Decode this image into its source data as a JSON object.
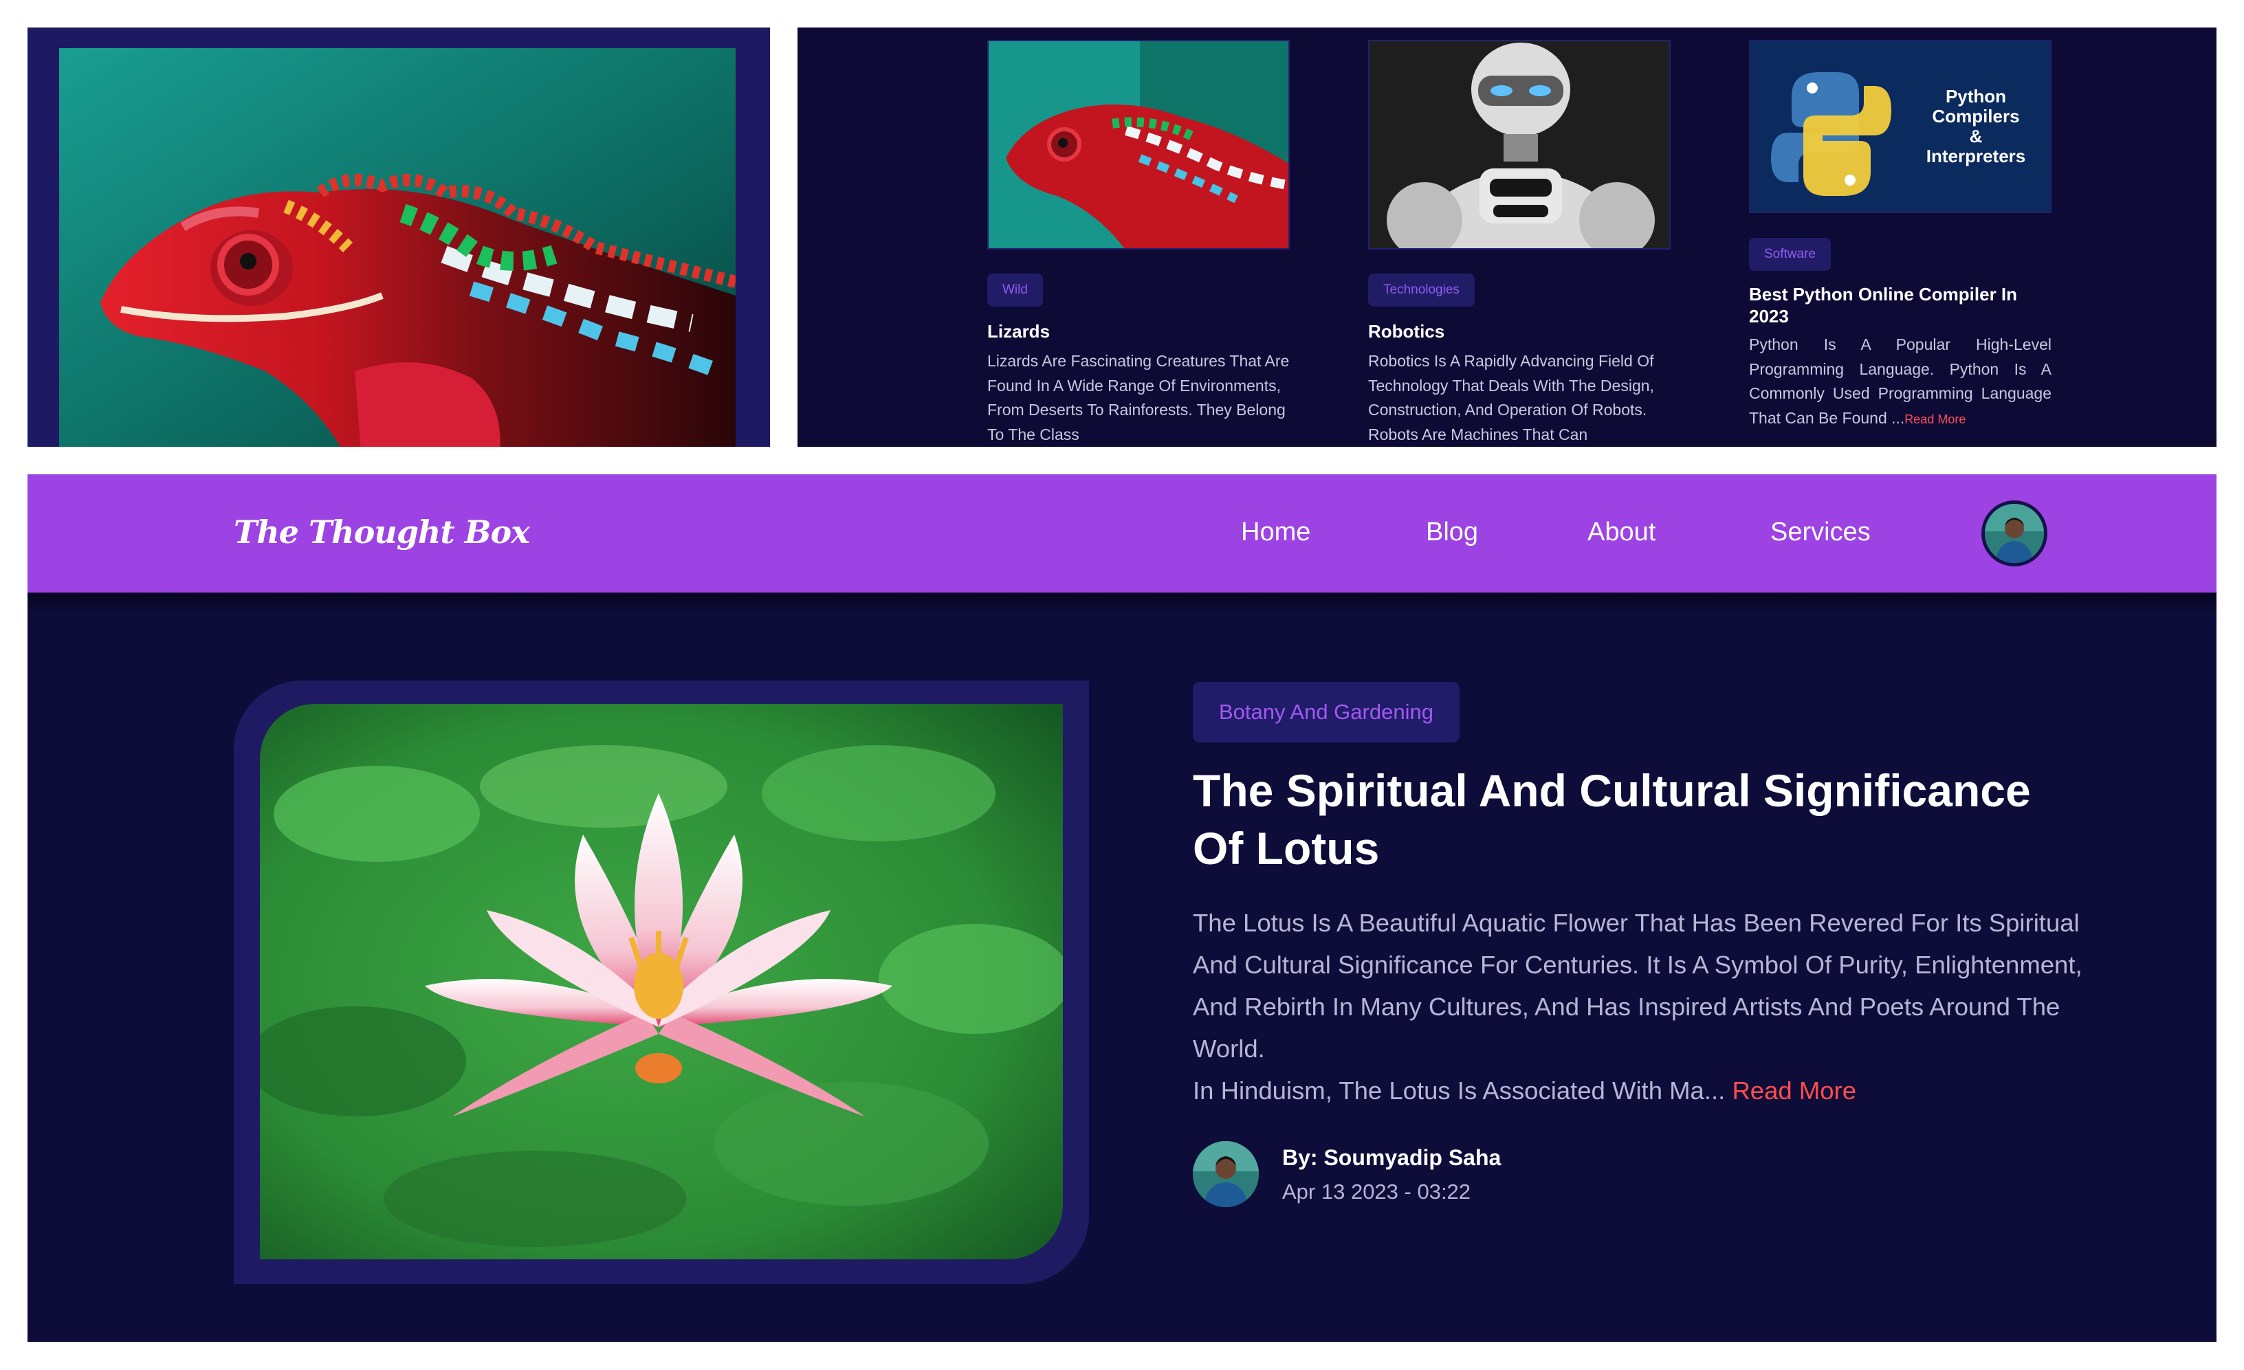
{
  "cards": [
    {
      "image": "chameleon-photo",
      "tag": "Wild",
      "title": "Lizards",
      "excerpt": "Lizards Are Fascinating Creatures That Are Found In A Wide Range Of Environments, From Deserts To Rainforests. They Belong To The Class"
    },
    {
      "image": "robot-photo",
      "tag": "Technologies",
      "title": "Robotics",
      "excerpt": "Robotics Is A Rapidly Advancing Field Of Technology That Deals With The Design, Construction, And Operation Of Robots. Robots Are Machines That Can"
    },
    {
      "image": "python-logo",
      "image_text": [
        "Python",
        "Compilers",
        "&",
        "Interpreters"
      ],
      "tag": "Software",
      "title": "Best Python Online Compiler In 2023",
      "excerpt": "Python Is A Popular High-Level Programming Language. Python Is A Commonly Used Programming Language That Can Be Found ...",
      "read_more": "Read More"
    }
  ],
  "navbar": {
    "logo": "The Thought Box",
    "items": [
      "Home",
      "Blog",
      "About",
      "Services"
    ]
  },
  "featured": {
    "image": "lotus-photo",
    "category": "Botany And Gardening",
    "title": "The Spiritual And Cultural Significance Of Lotus",
    "excerpt": "The Lotus Is A Beautiful Aquatic Flower That Has Been Revered For Its Spiritual And Cultural Significance For Centuries. It Is A Symbol Of Purity, Enlightenment, And Rebirth In Many Cultures, And Has Inspired Artists And Poets Around The World.",
    "excerpt_cont": "In Hinduism, The Lotus Is Associated With Ma...",
    "read_more": "Read More",
    "author": "By: Soumyadip Saha",
    "date": "Apr 13 2023 - 03:22"
  },
  "colors": {
    "navbar": "#9d42e3",
    "page_bg": "#0e0c39",
    "tag_bg": "#211c6a",
    "tag_text": "#a259f0",
    "read_more": "#ff4d4d"
  }
}
